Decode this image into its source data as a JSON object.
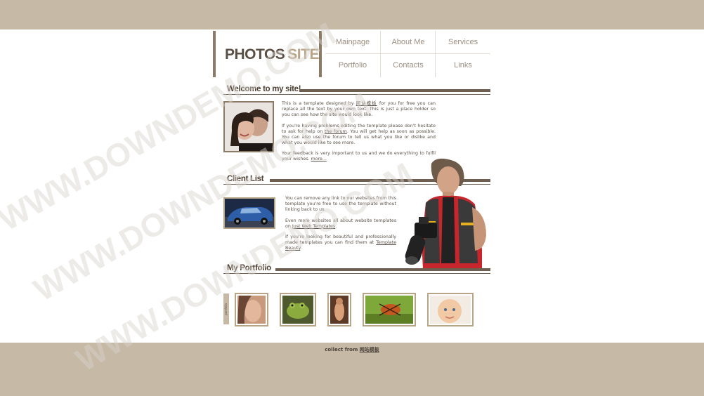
{
  "logo": {
    "word1": "PHOTOS",
    "word2": "SITE"
  },
  "nav": {
    "items": [
      {
        "label": "Mainpage"
      },
      {
        "label": "About Me"
      },
      {
        "label": "Services"
      },
      {
        "label": "Portfolio"
      },
      {
        "label": "Contacts"
      },
      {
        "label": "Links"
      }
    ]
  },
  "welcome": {
    "title": "Welcome to my site!",
    "p1_a": "This is a template designed by ",
    "p1_link": "网站模板",
    "p1_b": " for you for free you can replace all the text by your own text. This is just a place holder so you can see how the site would look like.",
    "p2_a": "If you're having problems editing the template please don't hesitate to ask for help on ",
    "p2_link": "the forum",
    "p2_b": ". You will get help as soon as possible. You can also use the forum to tell us what you like or dislike and what you would like to see more.",
    "p3_a": "Your feedback is very important to us and we do everything to fulfil your wishes. ",
    "p3_link": "more..."
  },
  "clients": {
    "title": "Client List",
    "p1": "You can remove any link to our websites from this template you're free to use the template without linking back to us.",
    "p2_a": "Even more websites all about website templates on ",
    "p2_link": "Just Web Templates",
    "p2_b": ".",
    "p3_a": "If you're looking for beautiful and professionally made templates you can find them at ",
    "p3_link": "Template Beauty",
    "p3_b": "."
  },
  "portfolio": {
    "title": "My Portfolio",
    "side_label": "portfolio"
  },
  "footer": {
    "prefix": "collect from ",
    "link": "网站模板"
  },
  "watermark": "WWW.DOWNDEMO.COM",
  "colors": {
    "band": "#c6b9a6",
    "accent": "#8b7a66",
    "heading": "#4d3f33",
    "logo_light": "#b8a588"
  }
}
